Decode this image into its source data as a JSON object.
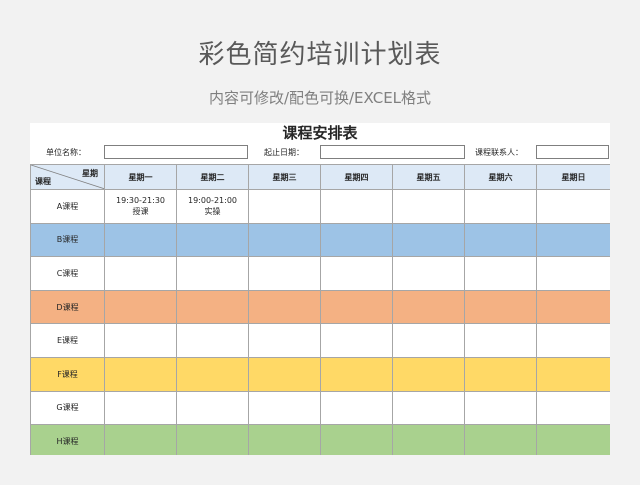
{
  "hero": {
    "title": "彩色简约培训计划表",
    "subtitle": "内容可修改/配色可换/EXCEL格式"
  },
  "sheet": {
    "title": "课程安排表",
    "unit_label": "单位名称：",
    "start_label": "起止日期：",
    "contact_label": "课程联系人：",
    "corner_top": "星期",
    "corner_bottom": "课程",
    "days": [
      "星期一",
      "星期二",
      "星期三",
      "星期四",
      "星期五",
      "星期六",
      "星期日"
    ],
    "rows": [
      {
        "name": "A课程",
        "color": "#ffffff",
        "cells": [
          [
            "19:30-21:30",
            "授课"
          ],
          [
            "19:00-21:00",
            "实操"
          ],
          [],
          [],
          [],
          [],
          []
        ]
      },
      {
        "name": "B课程",
        "color": "#9dc3e6",
        "cells": [
          [],
          [],
          [],
          [],
          [],
          [],
          []
        ]
      },
      {
        "name": "C课程",
        "color": "#ffffff",
        "cells": [
          [],
          [],
          [],
          [],
          [],
          [],
          []
        ]
      },
      {
        "name": "D课程",
        "color": "#f4b183",
        "cells": [
          [],
          [],
          [],
          [],
          [],
          [],
          []
        ]
      },
      {
        "name": "E课程",
        "color": "#ffffff",
        "cells": [
          [],
          [],
          [],
          [],
          [],
          [],
          []
        ]
      },
      {
        "name": "F课程",
        "color": "#ffd966",
        "cells": [
          [],
          [],
          [],
          [],
          [],
          [],
          []
        ]
      },
      {
        "name": "G课程",
        "color": "#ffffff",
        "cells": [
          [],
          [],
          [],
          [],
          [],
          [],
          []
        ]
      },
      {
        "name": "H课程",
        "color": "#a9d18e",
        "cells": [
          [],
          [],
          [],
          [],
          [],
          [],
          []
        ]
      }
    ]
  }
}
